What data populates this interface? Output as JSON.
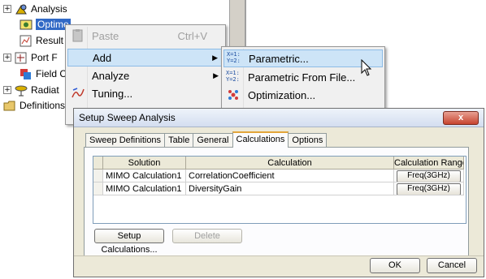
{
  "tree": {
    "items": [
      {
        "label": "Analysis",
        "expander": "+"
      },
      {
        "label": "Optimetrics",
        "expander": "",
        "selected": true,
        "display": "Optime"
      },
      {
        "label": "Result",
        "expander": ""
      },
      {
        "label": "Port F",
        "expander": "+"
      },
      {
        "label": "Field C",
        "expander": ""
      },
      {
        "label": "Radiat",
        "expander": "+"
      },
      {
        "label": "Definitions",
        "expander": ""
      }
    ]
  },
  "context_menu": {
    "items": [
      {
        "label": "Paste",
        "shortcut": "Ctrl+V",
        "disabled": true,
        "icon": "paste-icon"
      },
      {
        "label": "Add",
        "has_submenu": true,
        "highlighted": true
      },
      {
        "label": "Analyze",
        "has_submenu": true
      },
      {
        "label": "Tuning...",
        "icon": "tuning-icon"
      }
    ]
  },
  "submenu": {
    "items": [
      {
        "label": "Parametric...",
        "icon_text": "X=1:\nY=2:",
        "highlighted": true
      },
      {
        "label": "Parametric From File...",
        "icon_text": "X=1:\nY=2:"
      },
      {
        "label": "Optimization...",
        "icon": "optimization-icon"
      }
    ]
  },
  "dialog": {
    "title": "Setup Sweep Analysis",
    "close_label": "x",
    "tabs": [
      "Sweep Definitions",
      "Table",
      "General",
      "Calculations",
      "Options"
    ],
    "active_tab": "Calculations",
    "grid": {
      "columns": [
        "Solution",
        "Calculation",
        "Calculation Range"
      ],
      "rows": [
        {
          "solution": "MIMO Calculation1",
          "calculation": "CorrelationCoefficient",
          "range": "Freq(3GHz)"
        },
        {
          "solution": "MIMO Calculation1",
          "calculation": "DiversityGain",
          "range": "Freq(3GHz)"
        }
      ]
    },
    "setup_button": "Setup Calculations...",
    "delete_button": "Delete",
    "ok_button": "OK",
    "cancel_button": "Cancel"
  },
  "colors": {
    "selection": "#3169c6",
    "menu_highlight": "#cde4f7",
    "dialog_bg": "#ece9d8"
  }
}
